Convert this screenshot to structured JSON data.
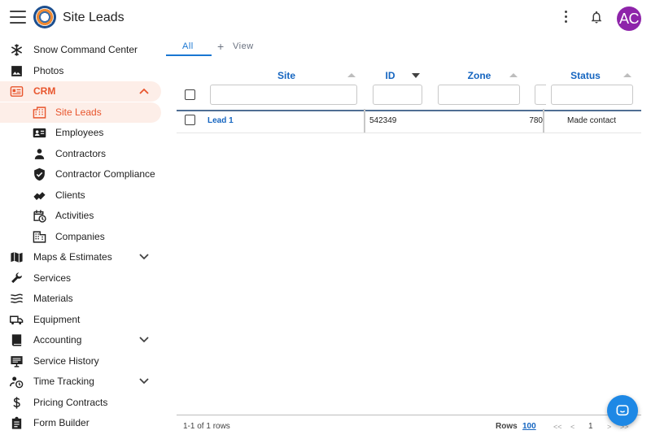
{
  "app": {
    "title": "Site Leads",
    "avatar_initials": "AC",
    "avatar_color": "#8e24aa",
    "accent": "#e8552d",
    "link_color": "#1565c0"
  },
  "sidebar": {
    "items": [
      {
        "label": "Snow Command Center",
        "icon": "snowflake-icon"
      },
      {
        "label": "Photos",
        "icon": "image-icon"
      },
      {
        "label": "CRM",
        "icon": "crm-card-icon",
        "expanded": true
      },
      {
        "label": "Site Leads",
        "icon": "building-icon",
        "active": true
      },
      {
        "label": "Employees",
        "icon": "id-badge-icon"
      },
      {
        "label": "Contractors",
        "icon": "person-icon"
      },
      {
        "label": "Contractor Compliance",
        "icon": "shield-check-icon"
      },
      {
        "label": "Clients",
        "icon": "handshake-icon"
      },
      {
        "label": "Activities",
        "icon": "calendar-clock-icon"
      },
      {
        "label": "Companies",
        "icon": "office-icon"
      },
      {
        "label": "Maps & Estimates",
        "icon": "map-icon"
      },
      {
        "label": "Services",
        "icon": "wrench-icon"
      },
      {
        "label": "Materials",
        "icon": "waves-icon"
      },
      {
        "label": "Equipment",
        "icon": "truck-icon"
      },
      {
        "label": "Accounting",
        "icon": "book-icon"
      },
      {
        "label": "Service History",
        "icon": "monitor-icon"
      },
      {
        "label": "Time Tracking",
        "icon": "person-clock-icon"
      },
      {
        "label": "Pricing Contracts",
        "icon": "dollar-icon"
      },
      {
        "label": "Form Builder",
        "icon": "clipboard-icon"
      }
    ]
  },
  "tabs": {
    "all": "All",
    "view": "View"
  },
  "table": {
    "columns": [
      "Site",
      "ID",
      "Zone",
      "Status"
    ],
    "rows": [
      {
        "site": "Lead 1",
        "id": "542349",
        "zone": "780",
        "status": "Made contact"
      }
    ]
  },
  "pager": {
    "info": "1-1 of 1 rows",
    "rows_label": "Rows",
    "rows_value": "100",
    "first": "<<",
    "prev": "<",
    "page": "1",
    "next": ">",
    "last": ">>"
  }
}
